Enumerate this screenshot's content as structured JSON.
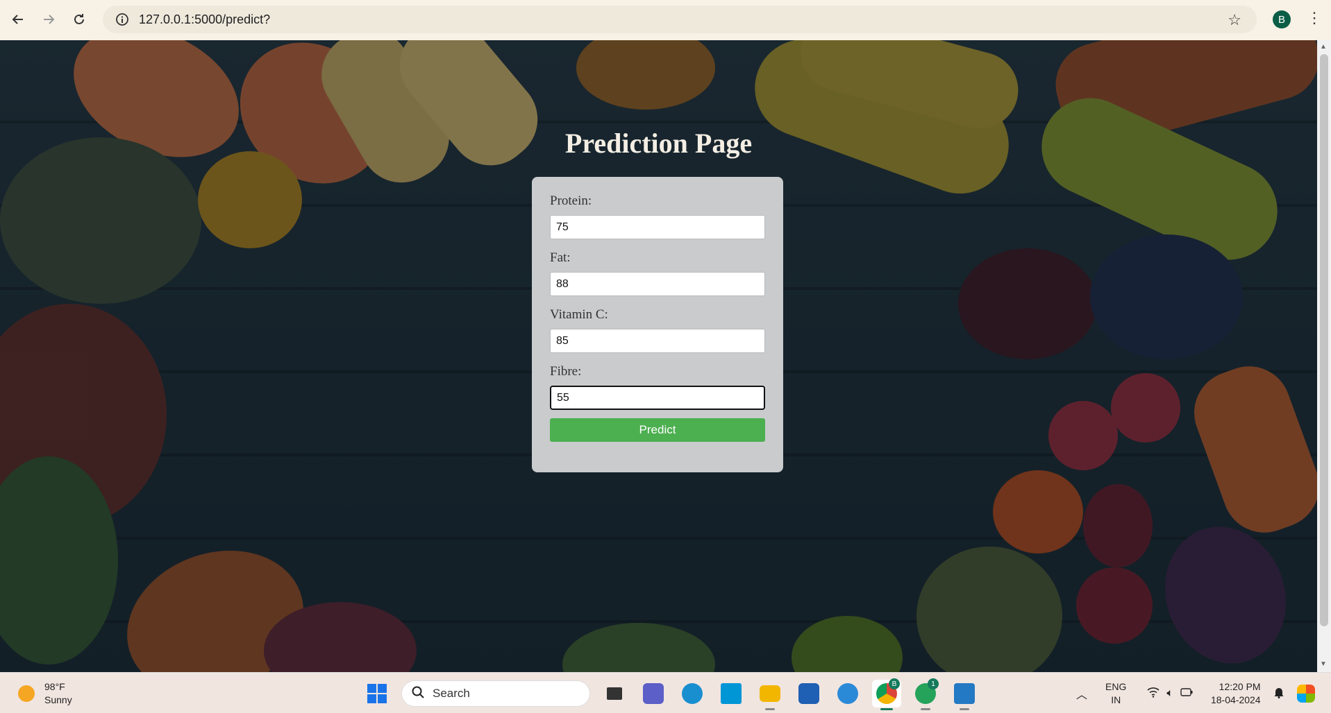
{
  "browser": {
    "url": "127.0.0.1:5000/predict?",
    "profile_initial": "B"
  },
  "page": {
    "title": "Prediction Page",
    "fields": [
      {
        "label": "Protein:",
        "value": "75"
      },
      {
        "label": "Fat:",
        "value": "88"
      },
      {
        "label": "Vitamin C:",
        "value": "85"
      },
      {
        "label": "Fibre:",
        "value": "55"
      }
    ],
    "submit_label": "Predict",
    "accent_color": "#4caf50"
  },
  "taskbar": {
    "weather_temp": "98°F",
    "weather_desc": "Sunny",
    "search_label": "Search",
    "chrome_badge": "B",
    "whatsapp_badge": "1",
    "lang_top": "ENG",
    "lang_bottom": "IN",
    "time": "12:20 PM",
    "date": "18-04-2024"
  }
}
